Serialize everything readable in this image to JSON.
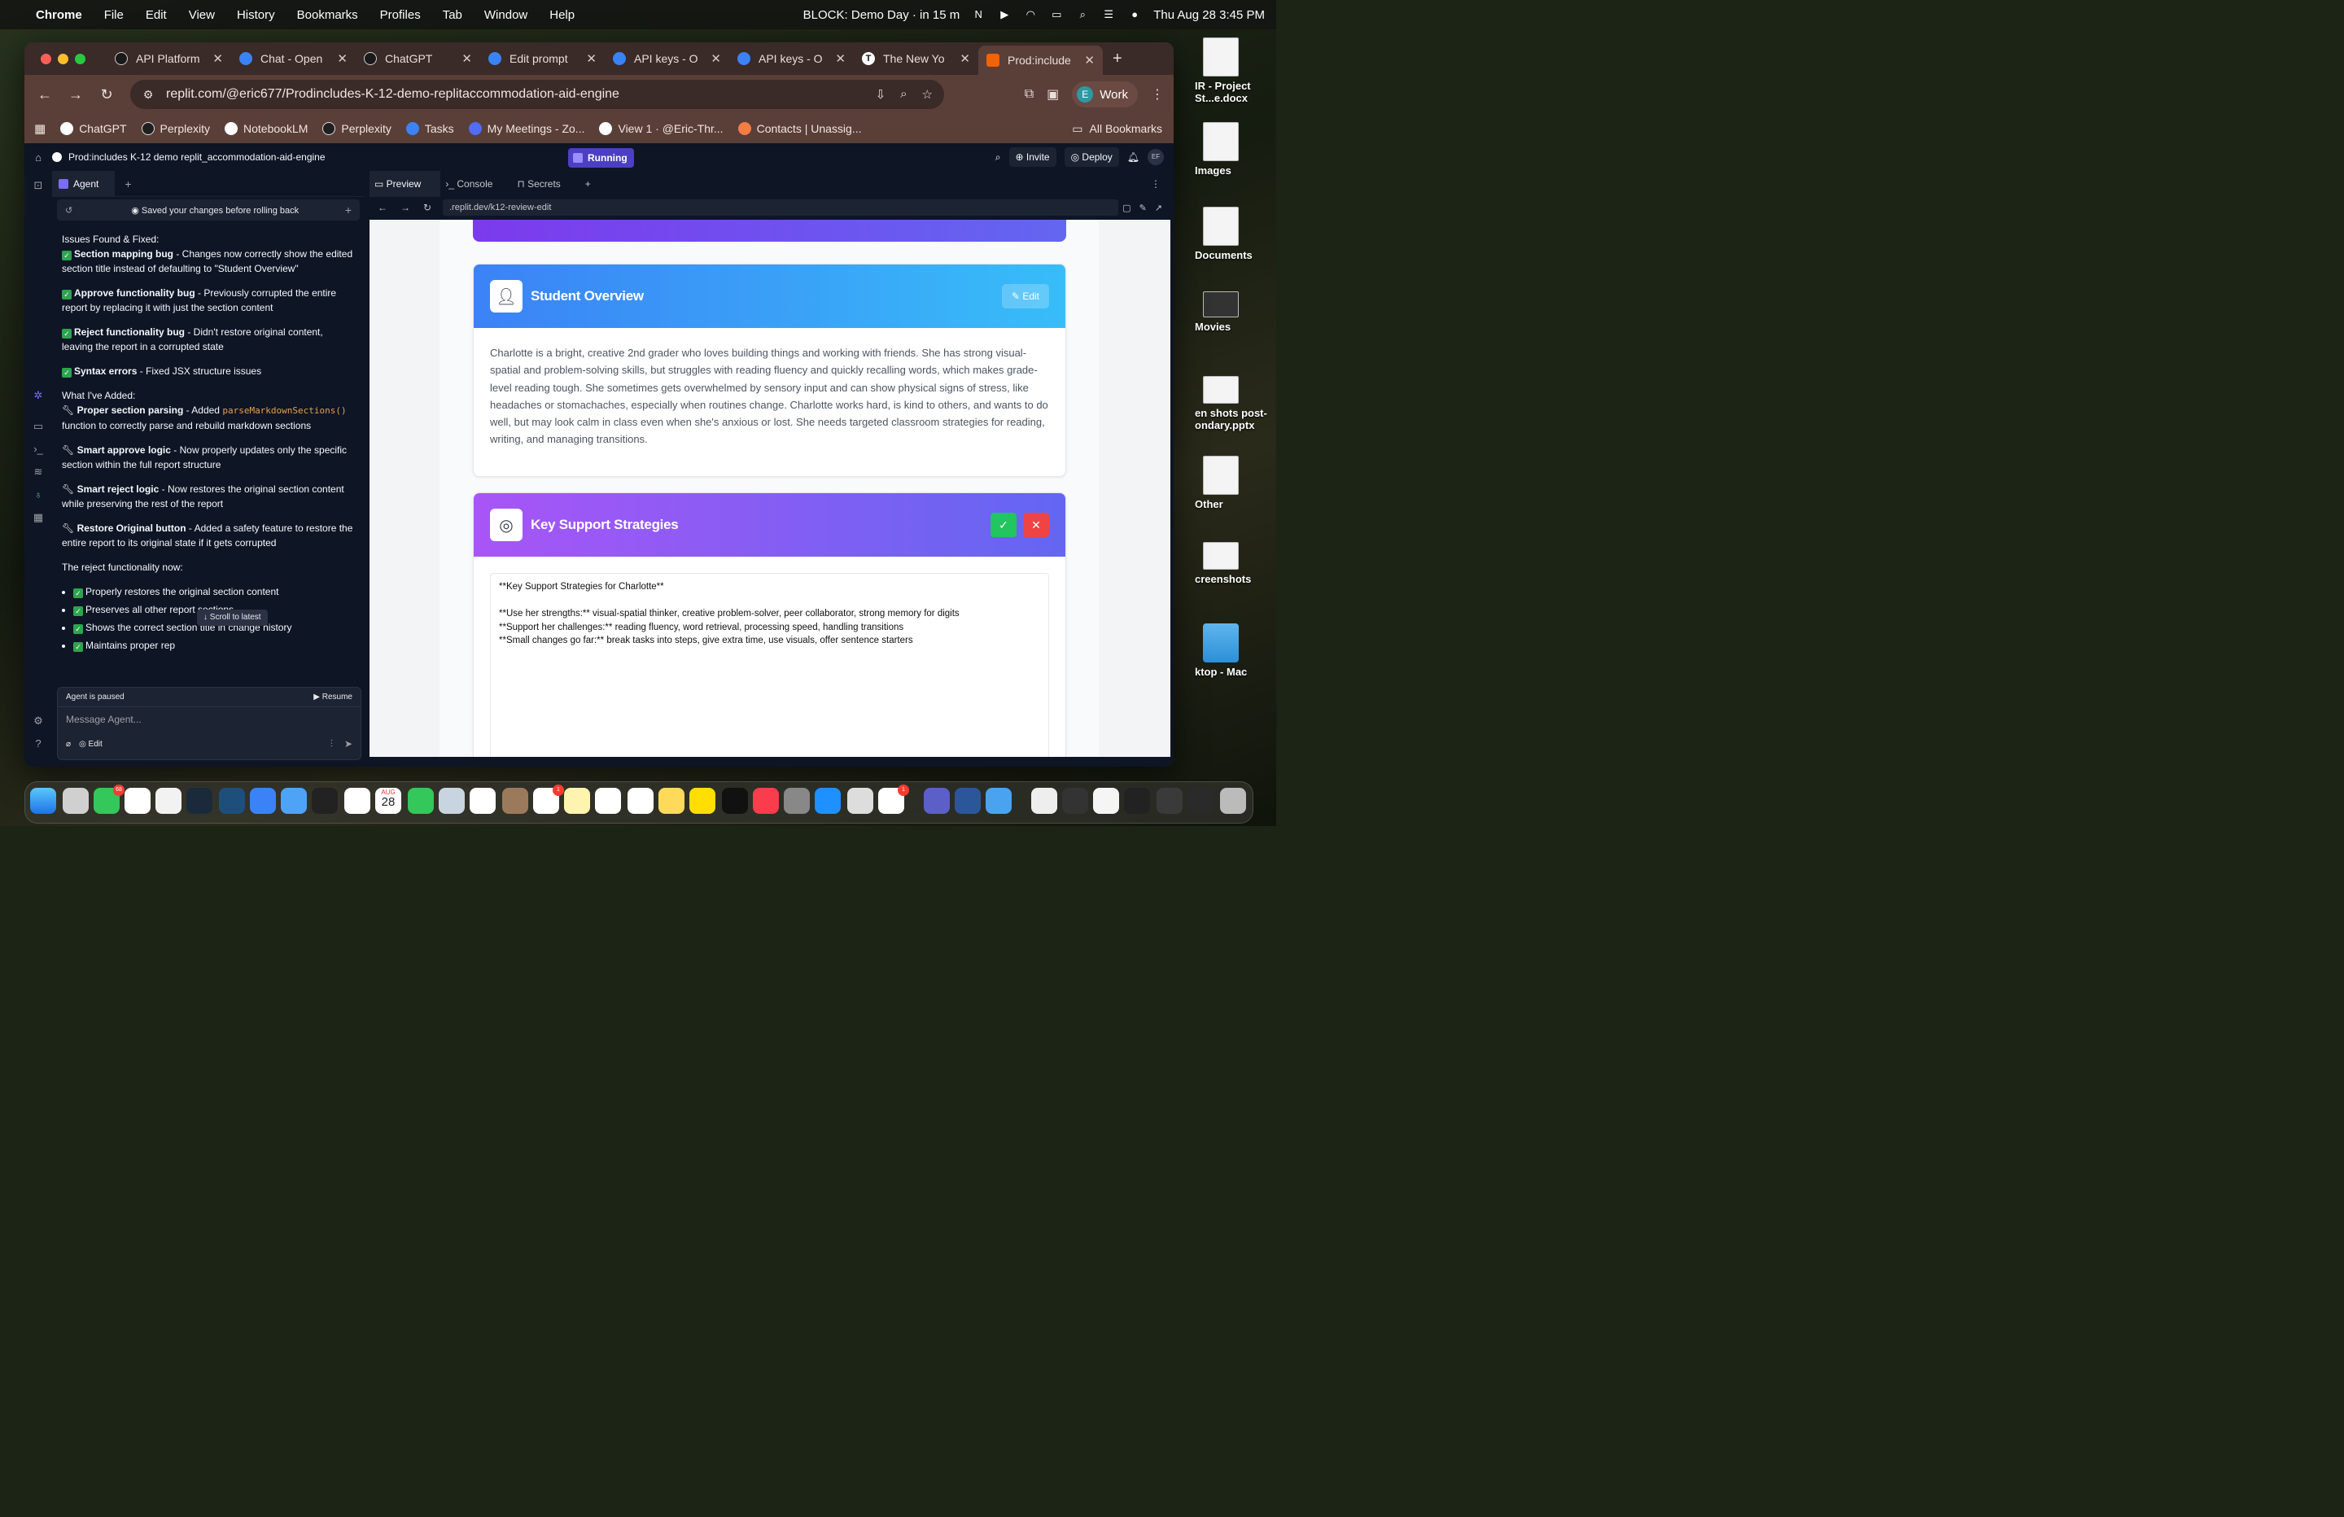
{
  "menubar": {
    "app": "Chrome",
    "items": [
      "File",
      "Edit",
      "View",
      "History",
      "Bookmarks",
      "Profiles",
      "Tab",
      "Window",
      "Help"
    ],
    "status": "BLOCK: Demo Day · in 15 m",
    "datetime": "Thu Aug 28  3:45 PM"
  },
  "desktop": {
    "items": [
      "IR - Project St...e.docx",
      "Images",
      "Documents",
      "Movies",
      "en shots post-ondary.pptx",
      "Other",
      "creenshots",
      "ktop - Mac"
    ]
  },
  "browser": {
    "tabs": [
      {
        "label": "API Platform",
        "color": "#1a1a1a"
      },
      {
        "label": "Chat - Open",
        "color": "#3b82f6"
      },
      {
        "label": "ChatGPT",
        "color": "#1a1a1a"
      },
      {
        "label": "Edit prompt",
        "color": "#3b82f6"
      },
      {
        "label": "API keys - O",
        "color": "#3b82f6"
      },
      {
        "label": "API keys - O",
        "color": "#3b82f6"
      },
      {
        "label": "The New Yo",
        "color": "#111111"
      },
      {
        "label": "Prod:include",
        "color": "#f26207"
      }
    ],
    "url": "replit.com/@eric677/Prodincludes-K-12-demo-replitaccommodation-aid-engine",
    "profile": {
      "initial": "E",
      "label": "Work"
    },
    "bookmarks": [
      "ChatGPT",
      "Perplexity",
      "NotebookLM",
      "Perplexity",
      "Tasks",
      "My Meetings - Zo...",
      "View 1 · @Eric-Thr...",
      "Contacts | Unassig..."
    ],
    "all_bookmarks": "All Bookmarks"
  },
  "replit": {
    "project_title": "Prod:includes K-12 demo replit_accommodation-aid-engine",
    "running": "Running",
    "invite": "Invite",
    "deploy": "Deploy",
    "avatar": "EF",
    "agent_tab": "Agent",
    "rollback_note": "Saved your changes before rolling back",
    "chat": {
      "issues_header": "Issues Found & Fixed:",
      "issues": [
        {
          "title": "Section mapping bug",
          "text": " - Changes now correctly show the edited section title instead of defaulting to \"Student Overview\""
        },
        {
          "title": "Approve functionality bug",
          "text": " - Previously corrupted the entire report by replacing it with just the section content"
        },
        {
          "title": "Reject functionality bug",
          "text": " - Didn't restore original content, leaving the report in a corrupted state"
        },
        {
          "title": "Syntax errors",
          "text": " - Fixed JSX structure issues"
        }
      ],
      "added_header": "What I've Added:",
      "added": [
        {
          "title": "Proper section parsing",
          "pre": " - Added ",
          "code": "parseMarkdownSections()",
          "text": " function to correctly parse and rebuild markdown sections"
        },
        {
          "title": "Smart approve logic",
          "pre": "",
          "code": "",
          "text": " - Now properly updates only the specific section within the full report structure"
        },
        {
          "title": "Smart reject logic",
          "pre": "",
          "code": "",
          "text": " - Now restores the original section content while preserving the rest of the report"
        },
        {
          "title": "Restore Original button",
          "pre": "",
          "code": "",
          "text": " - Added a safety feature to restore the entire report to its original state if it gets corrupted"
        }
      ],
      "reject_header": "The reject functionality now:",
      "reject_items": [
        "Properly restores the original section content",
        "Preserves all other report sections",
        "Shows the correct section title in change history",
        "Maintains proper rep"
      ]
    },
    "scroll_latest": "Scroll to latest",
    "paused": "Agent is paused",
    "resume": "Resume",
    "message_placeholder": "Message Agent...",
    "edit_label": "Edit",
    "preview_tabs": [
      "Preview",
      "Console",
      "Secrets"
    ],
    "preview_url": ".replit.dev/k12-review-edit"
  },
  "report": {
    "overview": {
      "title": "Student Overview",
      "edit": "Edit",
      "body": "Charlotte is a bright, creative 2nd grader who loves building things and working with friends. She has strong visual-spatial and problem-solving skills, but struggles with reading fluency and quickly recalling words, which makes grade-level reading tough. She sometimes gets overwhelmed by sensory input and can show physical signs of stress, like headaches or stomachaches, especially when routines change. Charlotte works hard, is kind to others, and wants to do well, but may look calm in class even when she's anxious or lost. She needs targeted classroom strategies for reading, writing, and managing transitions."
    },
    "strategies": {
      "title": "Key Support Strategies",
      "editor_text": "**Key Support Strategies for Charlotte**\n\n**Use her strengths:** visual-spatial thinker, creative problem-solver, peer collaborator, strong memory for digits\n**Support her challenges:** reading fluency, word retrieval, processing speed, handling transitions\n**Small changes go far:** break tasks into steps, give extra time, use visuals, offer sentence starters"
    }
  },
  "dock": {
    "badges": [
      "68",
      "1",
      "1"
    ],
    "calendar_month": "AUG",
    "calendar_day": "28"
  }
}
